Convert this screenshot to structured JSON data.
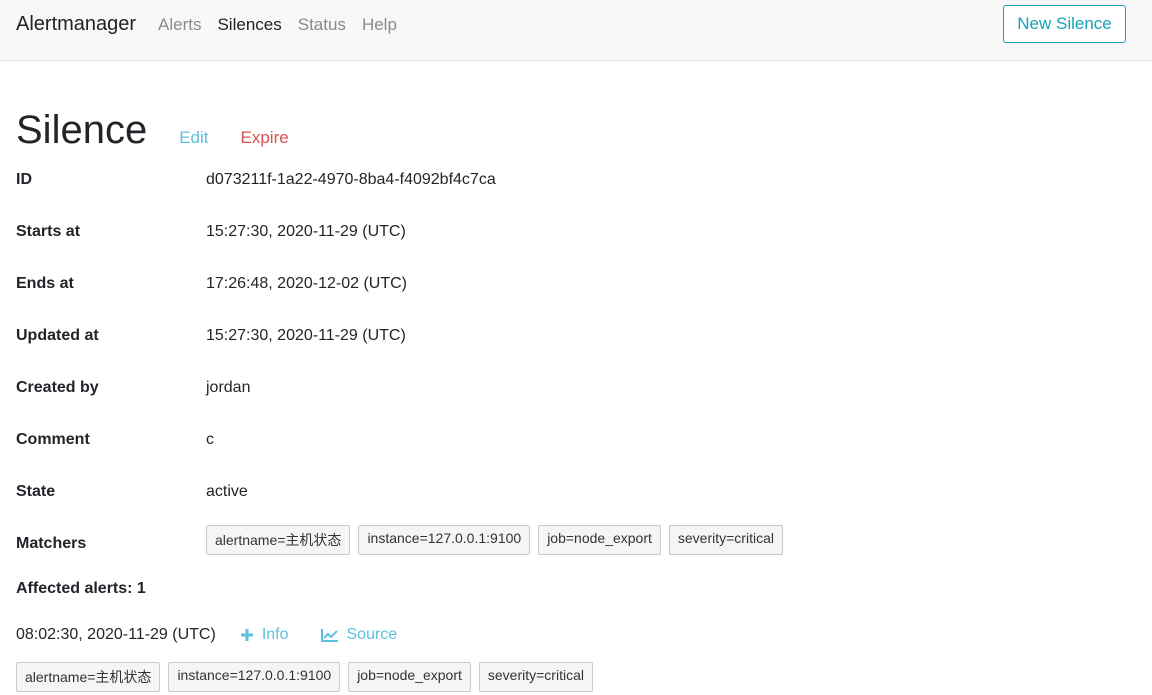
{
  "navbar": {
    "brand": "Alertmanager",
    "links": [
      "Alerts",
      "Silences",
      "Status",
      "Help"
    ],
    "new_silence": "New Silence"
  },
  "page": {
    "title": "Silence",
    "edit": "Edit",
    "expire": "Expire"
  },
  "details": [
    {
      "label": "ID",
      "value": "d073211f-1a22-4970-8ba4-f4092bf4c7ca"
    },
    {
      "label": "Starts at",
      "value": "15:27:30, 2020-11-29 (UTC)"
    },
    {
      "label": "Ends at",
      "value": "17:26:48, 2020-12-02 (UTC)"
    },
    {
      "label": "Updated at",
      "value": "15:27:30, 2020-11-29 (UTC)"
    },
    {
      "label": "Created by",
      "value": "jordan"
    },
    {
      "label": "Comment",
      "value": "c"
    },
    {
      "label": "State",
      "value": "active"
    }
  ],
  "matchers": {
    "label": "Matchers",
    "items": [
      "alertname=主机状态",
      "instance=127.0.0.1:9100",
      "job=node_export",
      "severity=critical"
    ]
  },
  "affected": {
    "title": "Affected alerts: 1",
    "alerts": [
      {
        "time": "08:02:30, 2020-11-29 (UTC)",
        "info": "Info",
        "source": "Source",
        "labels": [
          "alertname=主机状态",
          "instance=127.0.0.1:9100",
          "job=node_export",
          "severity=critical"
        ]
      }
    ]
  },
  "colors": {
    "accent": "#17a2b8",
    "link": "#5bc0de",
    "danger": "#d9534f"
  },
  "icons": {
    "info": "plus-icon",
    "source": "chart-line-icon"
  }
}
